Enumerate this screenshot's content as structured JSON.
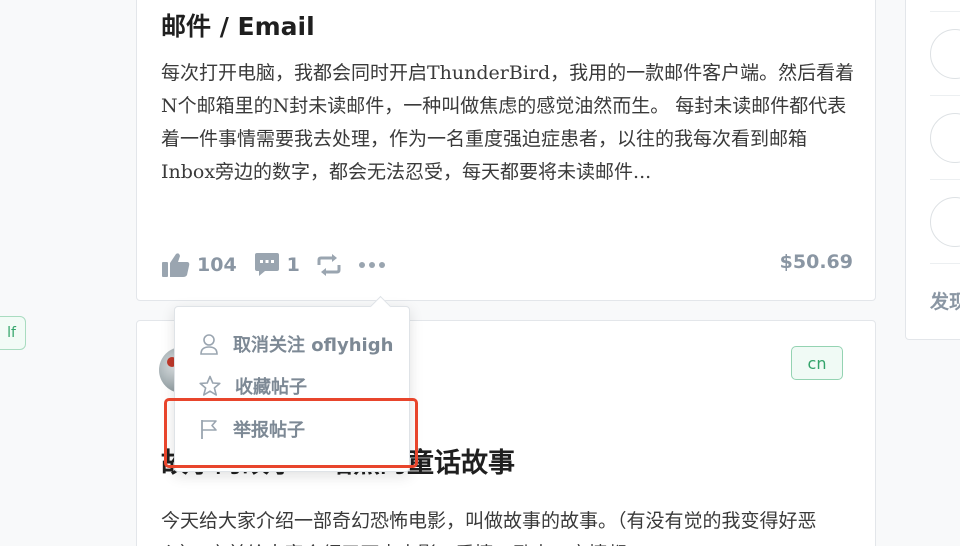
{
  "left_tag": {
    "label": "lf"
  },
  "post1": {
    "title": "邮件 / Email",
    "body": "每次打开电脑，我都会同时开启ThunderBird，我用的一款邮件客户端。然后看着N个邮箱里的N封未读邮件，一种叫做焦虑的感觉油然而生。 每封未读邮件都代表着一件事情需要我去处理，作为一名重度强迫症患者，以往的我每次看到邮箱Inbox旁边的数字，都会无法忍受，每天都要将未读邮件...",
    "votes": "104",
    "comments": "1",
    "price": "$50.69",
    "icons": {
      "like": "thumbs-up-icon",
      "comment": "comment-icon",
      "resteem": "repost-icon",
      "more": "more-dots-icon"
    }
  },
  "menu": {
    "items": [
      {
        "label": "取消关注 oflyhigh",
        "icon": "user-icon"
      },
      {
        "label": "收藏帖子",
        "icon": "star-icon"
      },
      {
        "label": "举报帖子",
        "icon": "flag-icon"
      }
    ],
    "highlight_color": "#e8452c"
  },
  "post2": {
    "tag": "cn",
    "title": "故事的故事 - 暗黑的童话故事",
    "title_visible": "童话故事",
    "body": "今天给大家介绍一部奇幻恐怖电影，叫做故事的故事。（有没有觉的我变得好恶心），之前给大家介绍了不少电影，爱情、励志、亲情都"
  },
  "sidebar": {
    "text": "发现"
  },
  "colors": {
    "tag_green": "#34a56b",
    "muted": "#8a96a3"
  }
}
